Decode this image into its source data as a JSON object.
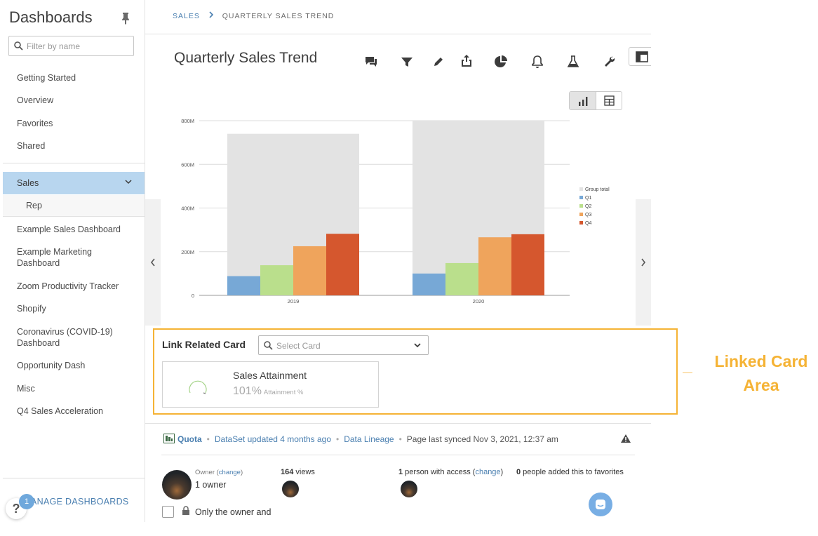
{
  "sidebar": {
    "title": "Dashboards",
    "filter_placeholder": "Filter by name",
    "items": [
      {
        "label": "Getting Started"
      },
      {
        "label": "Overview"
      },
      {
        "label": "Favorites"
      },
      {
        "label": "Shared"
      }
    ],
    "active_item": "Sales",
    "active_subitem": "Rep",
    "more_items": [
      {
        "label": "Example Sales Dashboard"
      },
      {
        "label": "Example Marketing Dashboard"
      },
      {
        "label": "Zoom Productivity Tracker"
      },
      {
        "label": "Shopify"
      },
      {
        "label": "Coronavirus (COVID-19) Dashboard"
      },
      {
        "label": "Opportunity Dash"
      },
      {
        "label": "Misc"
      },
      {
        "label": "Q4 Sales Acceleration"
      }
    ],
    "manage_label": "ANAGE DASHBOARDS",
    "help_label": "?",
    "help_badge": "1"
  },
  "header": {
    "breadcrumb_root": "SALES",
    "breadcrumb_current": "QUARTERLY SALES TREND",
    "card_title": "Quarterly Sales Trend"
  },
  "toolbar_icons": [
    "comments-icon",
    "filter-icon",
    "pencil-icon",
    "share-icon",
    "pie-chart-icon",
    "bell-icon",
    "beaker-icon",
    "wrench-icon",
    "layout-icon"
  ],
  "chart_data": {
    "type": "bar",
    "categories": [
      "2019",
      "2020"
    ],
    "series": [
      {
        "name": "Group total",
        "values": [
          740,
          800
        ],
        "color": "#e3e3e3"
      },
      {
        "name": "Q1",
        "values": [
          88,
          100
        ],
        "color": "#77a8d6"
      },
      {
        "name": "Q2",
        "values": [
          138,
          148
        ],
        "color": "#badf8c"
      },
      {
        "name": "Q3",
        "values": [
          225,
          266
        ],
        "color": "#efa45c"
      },
      {
        "name": "Q4",
        "values": [
          282,
          280
        ],
        "color": "#d5572e"
      }
    ],
    "yticks": [
      "0",
      "200M",
      "400M",
      "600M",
      "800M"
    ],
    "ylim": [
      0,
      800
    ],
    "legend_position": "right",
    "grid": true
  },
  "linked": {
    "label": "Link Related Card",
    "select_placeholder": "Select Card",
    "card_title": "Sales Attainment",
    "card_value": "101%",
    "card_unit": "Attainment %",
    "annotation": "Linked Card Area"
  },
  "info": {
    "dataset": "Quota",
    "dataset_updated": "DataSet updated 4 months ago",
    "lineage": "Data Lineage",
    "synced": "Page last synced Nov 3, 2021, 12:37 am",
    "owner_label": "Owner (",
    "owner_change": "change",
    "owner_label_end": ")",
    "owner_value": "1 owner",
    "views_count": "164",
    "views_label": " views",
    "access_count": "1",
    "access_label": " person with access (",
    "access_change": "change",
    "access_end": ")",
    "favs_count": "0",
    "favs_label": " people added this to favorites",
    "only_owner": "Only the owner and"
  },
  "colors": {
    "accent": "#4a7fb0",
    "annotation": "#f5b335",
    "active_bg": "#b8d6ef"
  }
}
